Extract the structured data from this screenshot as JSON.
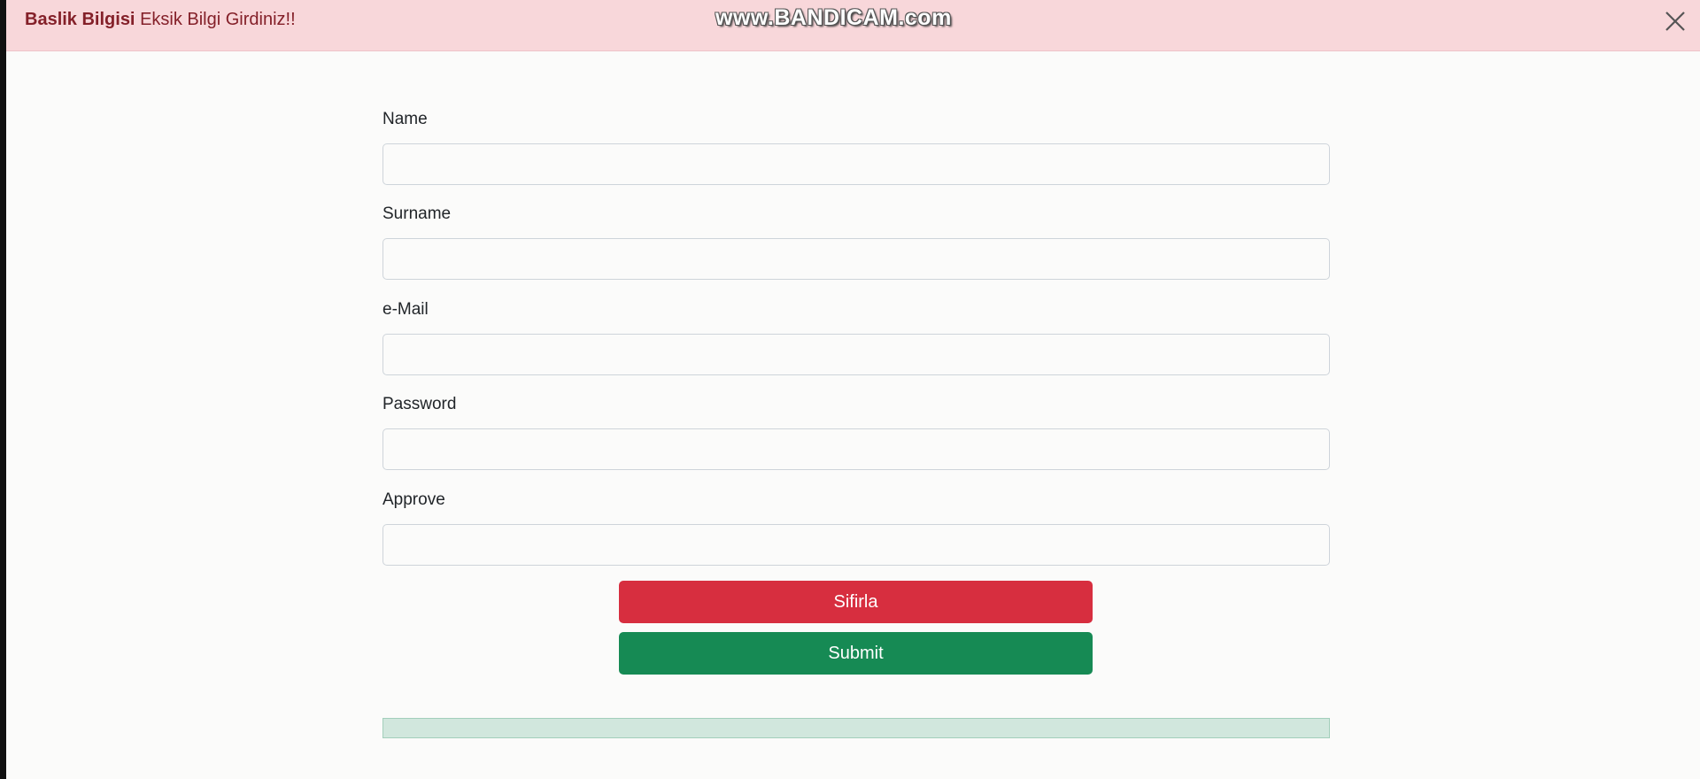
{
  "alert": {
    "title": "Baslik Bilgisi",
    "message": "Eksik Bilgi Girdiniz!!",
    "color": "#842029",
    "background": "#f8d7da"
  },
  "watermark": {
    "text": "www.BANDICAM.com"
  },
  "form": {
    "fields": [
      {
        "label": "Name",
        "value": ""
      },
      {
        "label": "Surname",
        "value": ""
      },
      {
        "label": "e-Mail",
        "value": ""
      },
      {
        "label": "Password",
        "value": ""
      },
      {
        "label": "Approve",
        "value": ""
      }
    ],
    "reset_label": "Sifirla",
    "submit_label": "Submit",
    "reset_color": "#d72e3f",
    "submit_color": "#168a54",
    "result_color": "#d1e7dd"
  },
  "icons": {
    "close": "close-icon"
  }
}
